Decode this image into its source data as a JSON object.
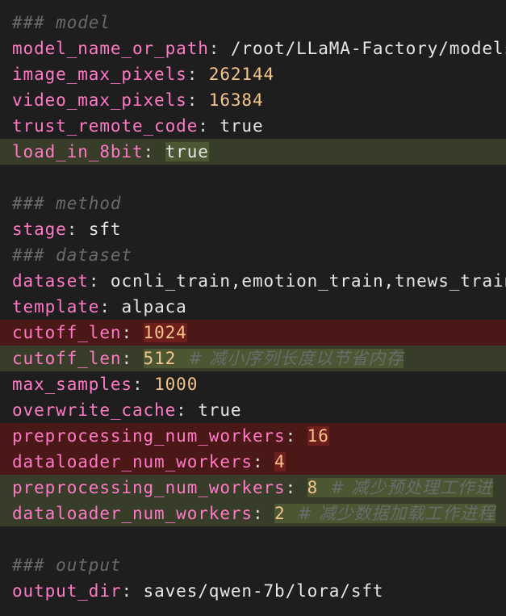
{
  "lines": [
    {
      "type": "comment",
      "text": "### model"
    },
    {
      "key": "model_name_or_path",
      "sep": ": ",
      "value": "/root/LLaMA-Factory/models/",
      "value_kind": "string"
    },
    {
      "key": "image_max_pixels",
      "sep": ": ",
      "value": "262144",
      "value_kind": "number"
    },
    {
      "key": "video_max_pixels",
      "sep": ": ",
      "value": "16384",
      "value_kind": "number"
    },
    {
      "key": "trust_remote_code",
      "sep": ": ",
      "value": "true",
      "value_kind": "string"
    },
    {
      "key": "load_in_8bit",
      "sep": ": ",
      "value": "true",
      "value_kind": "string",
      "diff": "added"
    },
    {
      "type": "blank"
    },
    {
      "type": "comment",
      "text": "### method"
    },
    {
      "key": "stage",
      "sep": ": ",
      "value": "sft",
      "value_kind": "string"
    },
    {
      "type": "comment",
      "text": "### dataset"
    },
    {
      "key": "dataset",
      "sep": ": ",
      "value": "ocnli_train,emotion_train,tnews_train",
      "value_kind": "string"
    },
    {
      "key": "template",
      "sep": ": ",
      "value": "alpaca",
      "value_kind": "string"
    },
    {
      "key": "cutoff_len",
      "sep": ": ",
      "value": "1024",
      "value_kind": "number",
      "diff": "removed"
    },
    {
      "key": "cutoff_len",
      "sep": ": ",
      "value": "512",
      "value_kind": "number",
      "diff": "added",
      "comment": "  # 减小序列长度以节省内存"
    },
    {
      "key": "max_samples",
      "sep": ": ",
      "value": "1000",
      "value_kind": "number"
    },
    {
      "key": "overwrite_cache",
      "sep": ": ",
      "value": "true",
      "value_kind": "string"
    },
    {
      "key": "preprocessing_num_workers",
      "sep": ": ",
      "value": "16",
      "value_kind": "number",
      "diff": "removed"
    },
    {
      "key": "dataloader_num_workers",
      "sep": ": ",
      "value": "4",
      "value_kind": "number",
      "diff": "removed"
    },
    {
      "key": "preprocessing_num_workers",
      "sep": ": ",
      "value": "8",
      "value_kind": "number",
      "diff": "added",
      "comment": "  # 减少预处理工作进"
    },
    {
      "key": "dataloader_num_workers",
      "sep": ": ",
      "value": "2",
      "value_kind": "number",
      "diff": "added",
      "comment": "  # 减少数据加载工作进程"
    },
    {
      "type": "blank"
    },
    {
      "type": "comment",
      "text": "### output"
    },
    {
      "key": "output_dir",
      "sep": ": ",
      "value": "saves/qwen-7b/lora/sft",
      "value_kind": "string"
    }
  ],
  "colors": {
    "background": "#1e1e1e",
    "key": "#ff79c6",
    "number": "#f5c48a",
    "comment": "#6a6a6a",
    "removed_line": "#4b1818",
    "added_line": "#373d29"
  }
}
